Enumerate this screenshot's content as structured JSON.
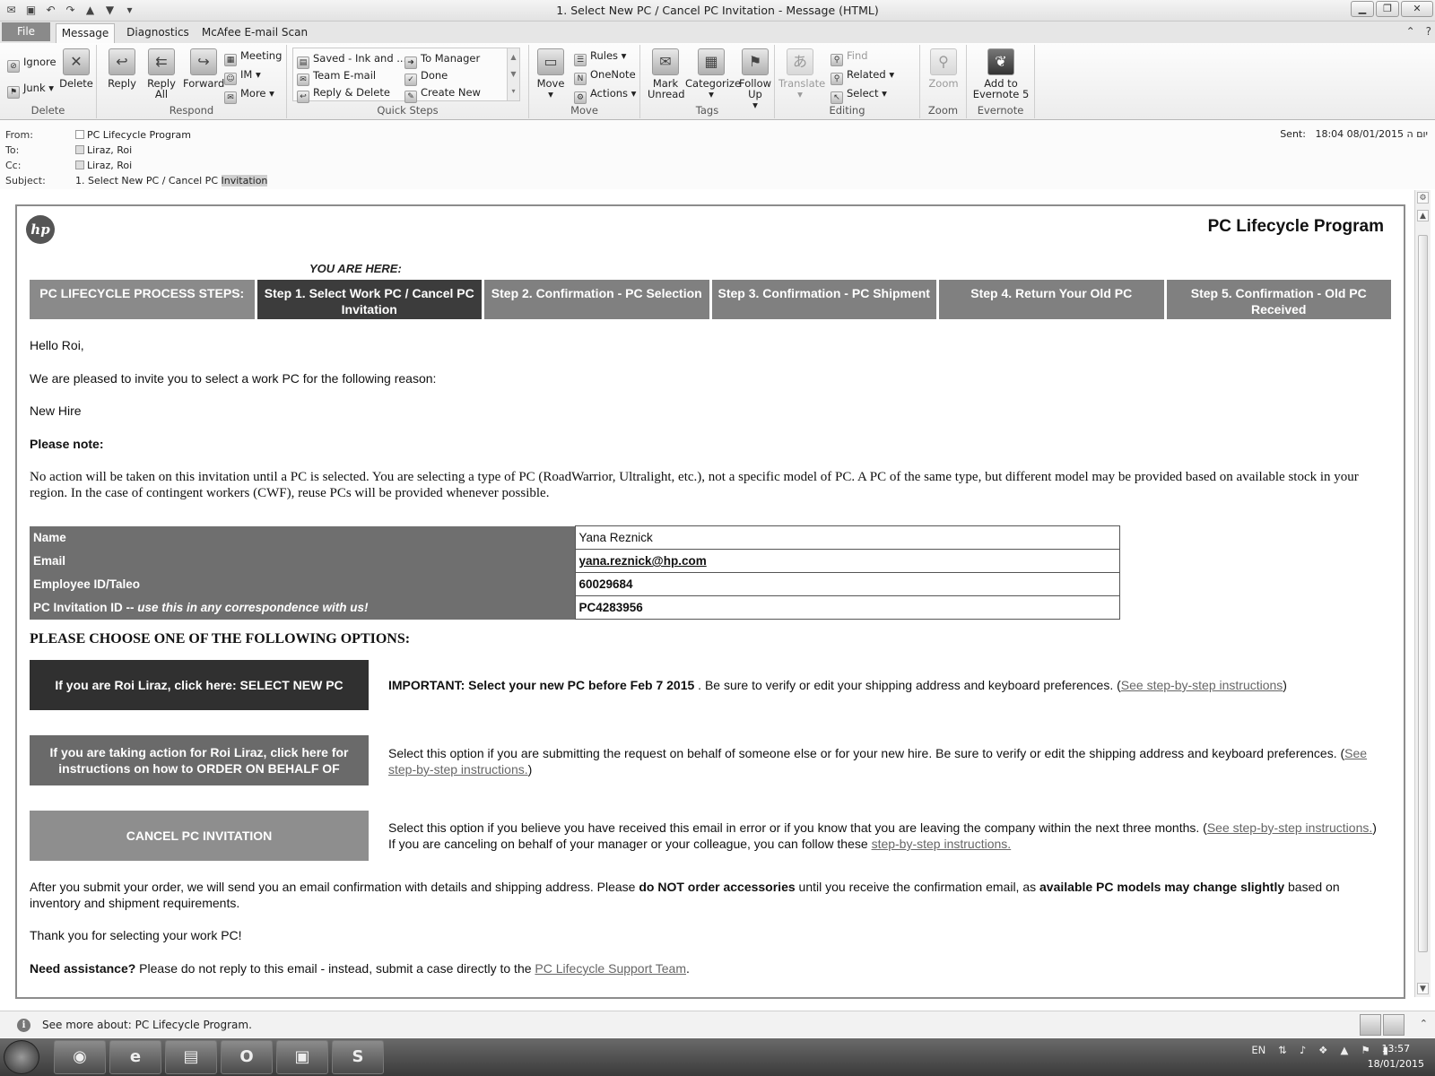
{
  "window": {
    "title": "1. Select New PC / Cancel PC Invitation  -  Message (HTML)",
    "min": "▁",
    "max": "❐",
    "close": "✕"
  },
  "ribbon_tabs": [
    {
      "label": "File"
    },
    {
      "label": "Message"
    },
    {
      "label": "Diagnostics"
    },
    {
      "label": "McAfee E-mail Scan"
    }
  ],
  "ribbon": {
    "delete": {
      "ignore": "Ignore",
      "junk": "Junk",
      "delete": "Delete",
      "label": "Delete"
    },
    "respond": {
      "reply": "Reply",
      "reply_all": "Reply All",
      "forward": "Forward",
      "meeting": "Meeting",
      "im": "IM",
      "more": "More",
      "label": "Respond"
    },
    "quick_steps": {
      "saved": "Saved - Ink and ...",
      "to_manager": "To Manager",
      "team_email": "Team E-mail",
      "done": "Done",
      "reply_delete": "Reply & Delete",
      "create_new": "Create New",
      "label": "Quick Steps"
    },
    "move": {
      "move": "Move",
      "rules": "Rules",
      "onenote": "OneNote",
      "actions": "Actions",
      "label": "Move"
    },
    "tags": {
      "mark_unread": "Mark Unread",
      "categorize": "Categorize",
      "follow_up": "Follow Up",
      "label": "Tags"
    },
    "editing": {
      "translate": "Translate",
      "find": "Find",
      "related": "Related",
      "select": "Select",
      "label": "Editing"
    },
    "zoom": {
      "zoom": "Zoom",
      "label": "Zoom"
    },
    "evernote": {
      "add": "Add to Evernote 5",
      "label": "Evernote"
    }
  },
  "header": {
    "from_label": "From:",
    "from": "PC Lifecycle Program",
    "to_label": "To:",
    "to": "Liraz, Roi",
    "cc_label": "Cc:",
    "cc": "Liraz, Roi",
    "subject_label": "Subject:",
    "subject_prefix": "1. Select New PC / Cancel PC ",
    "subject_highlight": "Invitation",
    "sent_label": "Sent:",
    "sent_value": "יום ה 08/01/2015 18:04"
  },
  "email": {
    "logo": "hp",
    "program_title": "PC Lifecycle Program",
    "you_are_here": "YOU ARE HERE:",
    "steps": [
      {
        "label": "PC LIFECYCLE PROCESS STEPS:"
      },
      {
        "label": "Step 1. Select Work PC / Cancel PC Invitation"
      },
      {
        "label": "Step 2. Confirmation - PC Selection"
      },
      {
        "label": "Step 3. Confirmation - PC Shipment"
      },
      {
        "label": "Step 4. Return Your Old PC"
      },
      {
        "label": "Step 5. Confirmation - Old PC Received"
      }
    ],
    "greeting": "Hello Roi,",
    "invite_line": "We are pleased to invite you to select a work PC for the following reason:",
    "reason": "New Hire",
    "note_head": "Please note:",
    "note_body": "No action will be taken on this invitation until a PC is selected. You are selecting a type of PC (RoadWarrior, Ultralight, etc.), not a specific model of PC. A PC of the same type, but different model may be provided based on available stock in your region. In the case of contingent workers (CWF), reuse PCs will be provided whenever possible.",
    "table": {
      "name_label": "Name",
      "name_value": "Yana Reznick",
      "email_label": "Email",
      "email_value": "yana.reznick@hp.com",
      "empid_label": "Employee ID/Taleo",
      "empid_value": "60029684",
      "invid_label": "PC Invitation ID -- ",
      "invid_label_em": "use this in any correspondence with us!",
      "invid_value": "PC4283956"
    },
    "choose_heading": "PLEASE CHOOSE ONE OF THE FOLLOWING OPTIONS:",
    "option1": {
      "button": "If you are Roi Liraz, click here: SELECT NEW PC",
      "important": "IMPORTANT: Select your new PC before Feb 7 2015",
      "text": " . Be sure to verify or edit your shipping address and keyboard preferences. (",
      "link": "See step-by-step instructions",
      "close": ")"
    },
    "option2": {
      "button": "If you are taking action for Roi Liraz, click here for instructions on how to ORDER ON BEHALF OF",
      "text": "Select this option if you are submitting the request on behalf of someone else or for your new hire. Be sure to verify or edit the shipping address and keyboard preferences. (",
      "link": "See step-by-step instructions.",
      "close": ")"
    },
    "option3": {
      "button": "CANCEL PC INVITATION",
      "text1": "Select this option if you believe you have received this email in error or if you know that you are leaving the company within the next three months. (",
      "link1": "See step-by-step instructions.",
      "close1": ")",
      "text2": "If you are canceling on behalf of your manager or your colleague, you can follow these ",
      "link2": "step-by-step instructions."
    },
    "after_p1": "After you submit your order, we will send you an email confirmation with details and shipping address. Please ",
    "after_b1": "do NOT order accessories",
    "after_p2": " until you receive the confirmation email, as ",
    "after_b2": "available PC models may change slightly",
    "after_p3": " based on inventory and shipment requirements.",
    "thanks": "Thank you for selecting your work PC!",
    "assist_b": "Need assistance?",
    "assist_text": " Please do not reply to this email - instead, submit a case directly to the ",
    "assist_link": "PC Lifecycle Support Team",
    "assist_end": "."
  },
  "infobar": {
    "text": "See more about: PC Lifecycle Program."
  },
  "taskbar": {
    "lang": "EN",
    "time": "13:57",
    "date": "18/01/2015",
    "skype": "S"
  }
}
